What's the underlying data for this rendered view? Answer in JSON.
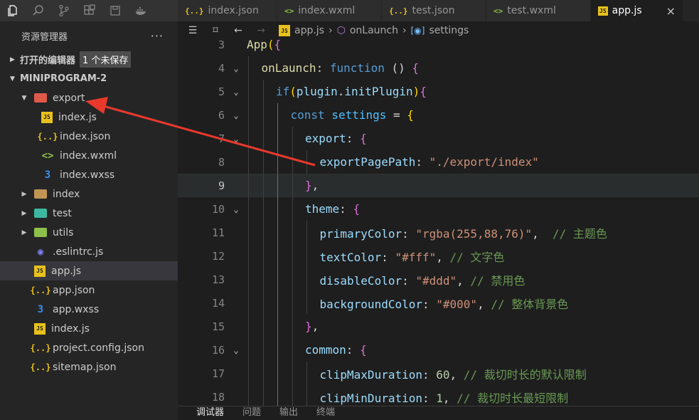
{
  "tabs": [
    {
      "icon": "{..}",
      "label": "index.json",
      "type": "json"
    },
    {
      "icon": "<>",
      "label": "index.wxml",
      "type": "wxml"
    },
    {
      "icon": "{..}",
      "label": "test.json",
      "type": "json"
    },
    {
      "icon": "<>",
      "label": "test.wxml",
      "type": "wxml"
    },
    {
      "icon": "JS",
      "label": "app.js",
      "type": "js",
      "active": true
    }
  ],
  "tab_close": "×",
  "sidebar": {
    "title": "资源管理器",
    "more": "···",
    "open_editors": {
      "label": "打开的编辑器",
      "badge": "1 个未保存"
    },
    "project": {
      "label": "MINIPROGRAM-2"
    },
    "tree": [
      {
        "label": "export",
        "kind": "folder",
        "expanded": true,
        "color": "#e05a4a"
      },
      {
        "label": "index.js",
        "kind": "js",
        "child": true
      },
      {
        "label": "index.json",
        "kind": "json",
        "child": true
      },
      {
        "label": "index.wxml",
        "kind": "wxml",
        "child": true
      },
      {
        "label": "index.wxss",
        "kind": "wxss",
        "child": true
      },
      {
        "label": "index",
        "kind": "folder",
        "color": "#c09553"
      },
      {
        "label": "test",
        "kind": "folder",
        "color": "#3db8a0"
      },
      {
        "label": "utils",
        "kind": "folder",
        "color": "#8dc149"
      },
      {
        "label": ".eslintrc.js",
        "kind": "eslint"
      },
      {
        "label": "app.js",
        "kind": "js",
        "selected": true
      },
      {
        "label": "app.json",
        "kind": "json"
      },
      {
        "label": "app.wxss",
        "kind": "wxss"
      },
      {
        "label": "index.js",
        "kind": "js"
      },
      {
        "label": "project.config.json",
        "kind": "json"
      },
      {
        "label": "sitemap.json",
        "kind": "json"
      }
    ]
  },
  "icons": {
    "js": "JS",
    "json": "{..}",
    "wxml": "<>",
    "wxss": "3",
    "eslint": "◉"
  },
  "breadcrumb": {
    "file": "app.js",
    "method": "onLaunch",
    "variable": "settings",
    "sep": "›"
  },
  "editor": {
    "current_line": 9,
    "lines": [
      {
        "n": 3,
        "fold": "",
        "indent": 0,
        "tokens": [
          [
            "App",
            "t-fn"
          ],
          [
            "(",
            "t-br"
          ],
          [
            "{",
            "t-br2"
          ]
        ]
      },
      {
        "n": 4,
        "fold": "⌄",
        "indent": 1,
        "tokens": [
          [
            "onLaunch",
            "t-fn"
          ],
          [
            ": ",
            "t-def"
          ],
          [
            "function",
            "t-kw"
          ],
          [
            " () ",
            "t-def"
          ],
          [
            "{",
            "t-br2"
          ]
        ]
      },
      {
        "n": 5,
        "fold": "⌄",
        "indent": 2,
        "tokens": [
          [
            "if",
            "t-kw"
          ],
          [
            "(",
            "t-br"
          ],
          [
            "plugin",
            "t-prop"
          ],
          [
            ".",
            "t-def"
          ],
          [
            "initPlugin",
            "t-prop"
          ],
          [
            ")",
            "t-br"
          ],
          [
            "{",
            "t-br2"
          ]
        ]
      },
      {
        "n": 6,
        "fold": "⌄",
        "indent": 3,
        "tokens": [
          [
            "const",
            "t-kw"
          ],
          [
            " ",
            "t-def"
          ],
          [
            "settings",
            "t-var"
          ],
          [
            " = ",
            "t-def"
          ],
          [
            "{",
            "t-br"
          ]
        ]
      },
      {
        "n": 7,
        "fold": "⌄",
        "indent": 4,
        "tokens": [
          [
            "export",
            "t-prop"
          ],
          [
            ": ",
            "t-def"
          ],
          [
            "{",
            "t-br2"
          ]
        ]
      },
      {
        "n": 8,
        "fold": "",
        "indent": 5,
        "tokens": [
          [
            "exportPagePath",
            "t-prop"
          ],
          [
            ": ",
            "t-def"
          ],
          [
            "\"./export/index\"",
            "t-str"
          ]
        ]
      },
      {
        "n": 9,
        "fold": "",
        "indent": 4,
        "tokens": [
          [
            "}",
            "t-br2"
          ],
          [
            ",",
            "t-def"
          ]
        ]
      },
      {
        "n": 10,
        "fold": "⌄",
        "indent": 4,
        "tokens": [
          [
            "theme",
            "t-prop"
          ],
          [
            ": ",
            "t-def"
          ],
          [
            "{",
            "t-br2"
          ]
        ]
      },
      {
        "n": 11,
        "fold": "",
        "indent": 5,
        "tokens": [
          [
            "primaryColor",
            "t-prop"
          ],
          [
            ": ",
            "t-def"
          ],
          [
            "\"rgba(255,88,76)\"",
            "t-str"
          ],
          [
            ",  ",
            "t-def"
          ],
          [
            "// 主题色",
            "t-com"
          ]
        ]
      },
      {
        "n": 12,
        "fold": "",
        "indent": 5,
        "tokens": [
          [
            "textColor",
            "t-prop"
          ],
          [
            ": ",
            "t-def"
          ],
          [
            "\"#fff\"",
            "t-str"
          ],
          [
            ", ",
            "t-def"
          ],
          [
            "// 文字色",
            "t-com"
          ]
        ]
      },
      {
        "n": 13,
        "fold": "",
        "indent": 5,
        "tokens": [
          [
            "disableColor",
            "t-prop"
          ],
          [
            ": ",
            "t-def"
          ],
          [
            "\"#ddd\"",
            "t-str"
          ],
          [
            ", ",
            "t-def"
          ],
          [
            "// 禁用色",
            "t-com"
          ]
        ]
      },
      {
        "n": 14,
        "fold": "",
        "indent": 5,
        "tokens": [
          [
            "backgroundColor",
            "t-prop"
          ],
          [
            ": ",
            "t-def"
          ],
          [
            "\"#000\"",
            "t-str"
          ],
          [
            ", ",
            "t-def"
          ],
          [
            "// 整体背景色",
            "t-com"
          ]
        ]
      },
      {
        "n": 15,
        "fold": "",
        "indent": 4,
        "tokens": [
          [
            "}",
            "t-br2"
          ],
          [
            ",",
            "t-def"
          ]
        ]
      },
      {
        "n": 16,
        "fold": "⌄",
        "indent": 4,
        "tokens": [
          [
            "common",
            "t-prop"
          ],
          [
            ": ",
            "t-def"
          ],
          [
            "{",
            "t-br2"
          ]
        ]
      },
      {
        "n": 17,
        "fold": "",
        "indent": 5,
        "tokens": [
          [
            "clipMaxDuration",
            "t-prop"
          ],
          [
            ": ",
            "t-def"
          ],
          [
            "60",
            "t-num"
          ],
          [
            ", ",
            "t-def"
          ],
          [
            "// 裁切时长的默认限制",
            "t-com"
          ]
        ]
      },
      {
        "n": 18,
        "fold": "",
        "indent": 5,
        "tokens": [
          [
            "clipMinDuration",
            "t-prop"
          ],
          [
            ": ",
            "t-def"
          ],
          [
            "1",
            "t-num"
          ],
          [
            ", ",
            "t-def"
          ],
          [
            "// 裁切时长最短限制",
            "t-com"
          ]
        ]
      }
    ]
  },
  "panel_tabs": [
    "调试器",
    "问题",
    "输出",
    "终端"
  ]
}
